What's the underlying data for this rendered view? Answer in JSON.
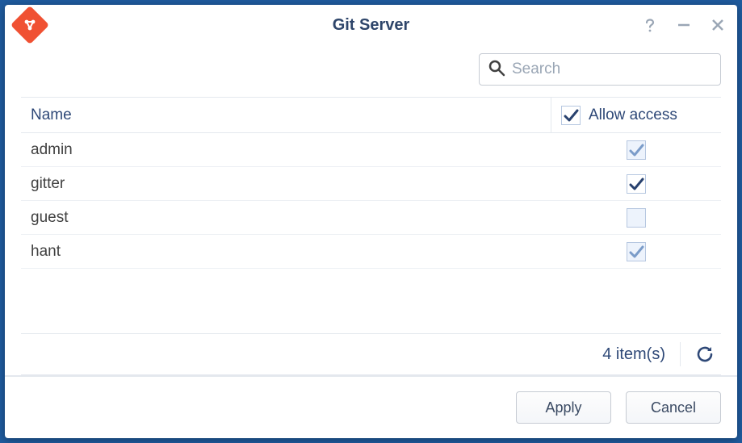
{
  "window": {
    "title": "Git Server"
  },
  "search": {
    "placeholder": "Search"
  },
  "columns": {
    "name": "Name",
    "allow": "Allow access"
  },
  "header_checkbox": {
    "state": "checked-strong"
  },
  "rows": [
    {
      "name": "admin",
      "state": "checked-weak"
    },
    {
      "name": "gitter",
      "state": "checked-strong"
    },
    {
      "name": "guest",
      "state": "empty"
    },
    {
      "name": "hant",
      "state": "checked-weak"
    }
  ],
  "footer": {
    "count_text": "4 item(s)"
  },
  "buttons": {
    "apply": "Apply",
    "cancel": "Cancel"
  }
}
